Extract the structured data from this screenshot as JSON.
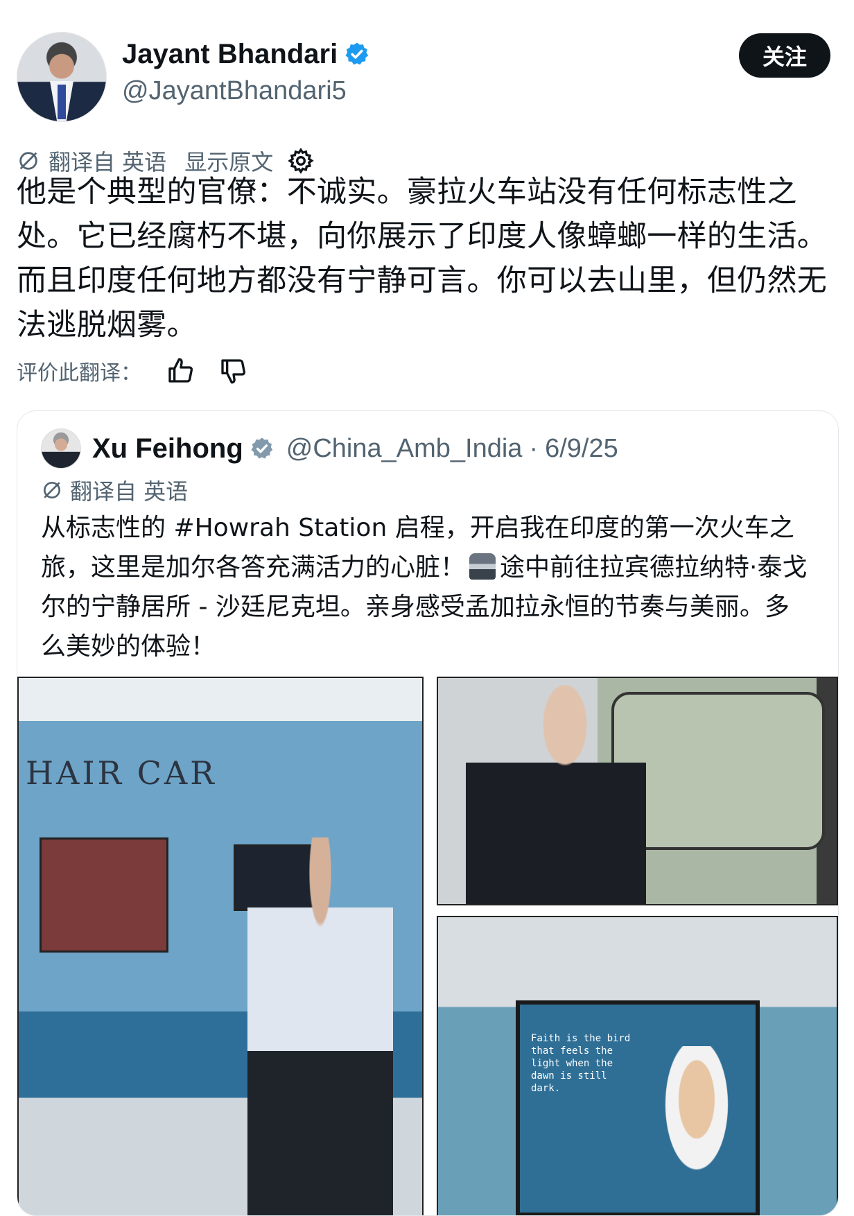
{
  "post": {
    "author_name": "Jayant Bhandari",
    "author_handle": "@JayantBhandari5",
    "follow_label": "关注",
    "translated_from": "翻译自 英语",
    "show_original": "显示原文",
    "text": "他是个典型的官僚：不诚实。豪拉火车站没有任何标志性之处。它已经腐朽不堪，向你展示了印度人像蟑螂一样的生活。而且印度任何地方都没有宁静可言。你可以去山里，但仍然无法逃脱烟雾。",
    "rate_label": "评价此翻译："
  },
  "quote": {
    "author_name": "Xu Feihong",
    "author_handle": "@China_Amb_India",
    "separator": "·",
    "date": "6/9/25",
    "translated_from": "翻译自 英语",
    "text_part1": "从标志性的 #Howrah Station 启程，开启我在印度的第一次火车之旅，这里是加尔各答充满活力的心脏！",
    "text_part2": "途中前往拉宾德拉纳特·泰戈尔的宁静居所 - 沙廷尼克坦。亲身感受孟加拉永恒的节奏与美丽。多么美妙的体验！",
    "images": {
      "left_car_label": "HAIR CAR",
      "poster_quote": "Faith is the bird that feels the light when the dawn is still dark."
    }
  },
  "icons": {
    "verified": "verified-badge-icon",
    "translate": "translate-icon",
    "settings": "gear-icon",
    "thumbs_up": "thumbs-up-icon",
    "thumbs_down": "thumbs-down-icon",
    "train": "train-emoji"
  },
  "colors": {
    "verified_blue": "#1d9bf0",
    "verified_gray": "#829aab",
    "follow_bg": "#0f1419",
    "secondary_text": "#536471"
  }
}
